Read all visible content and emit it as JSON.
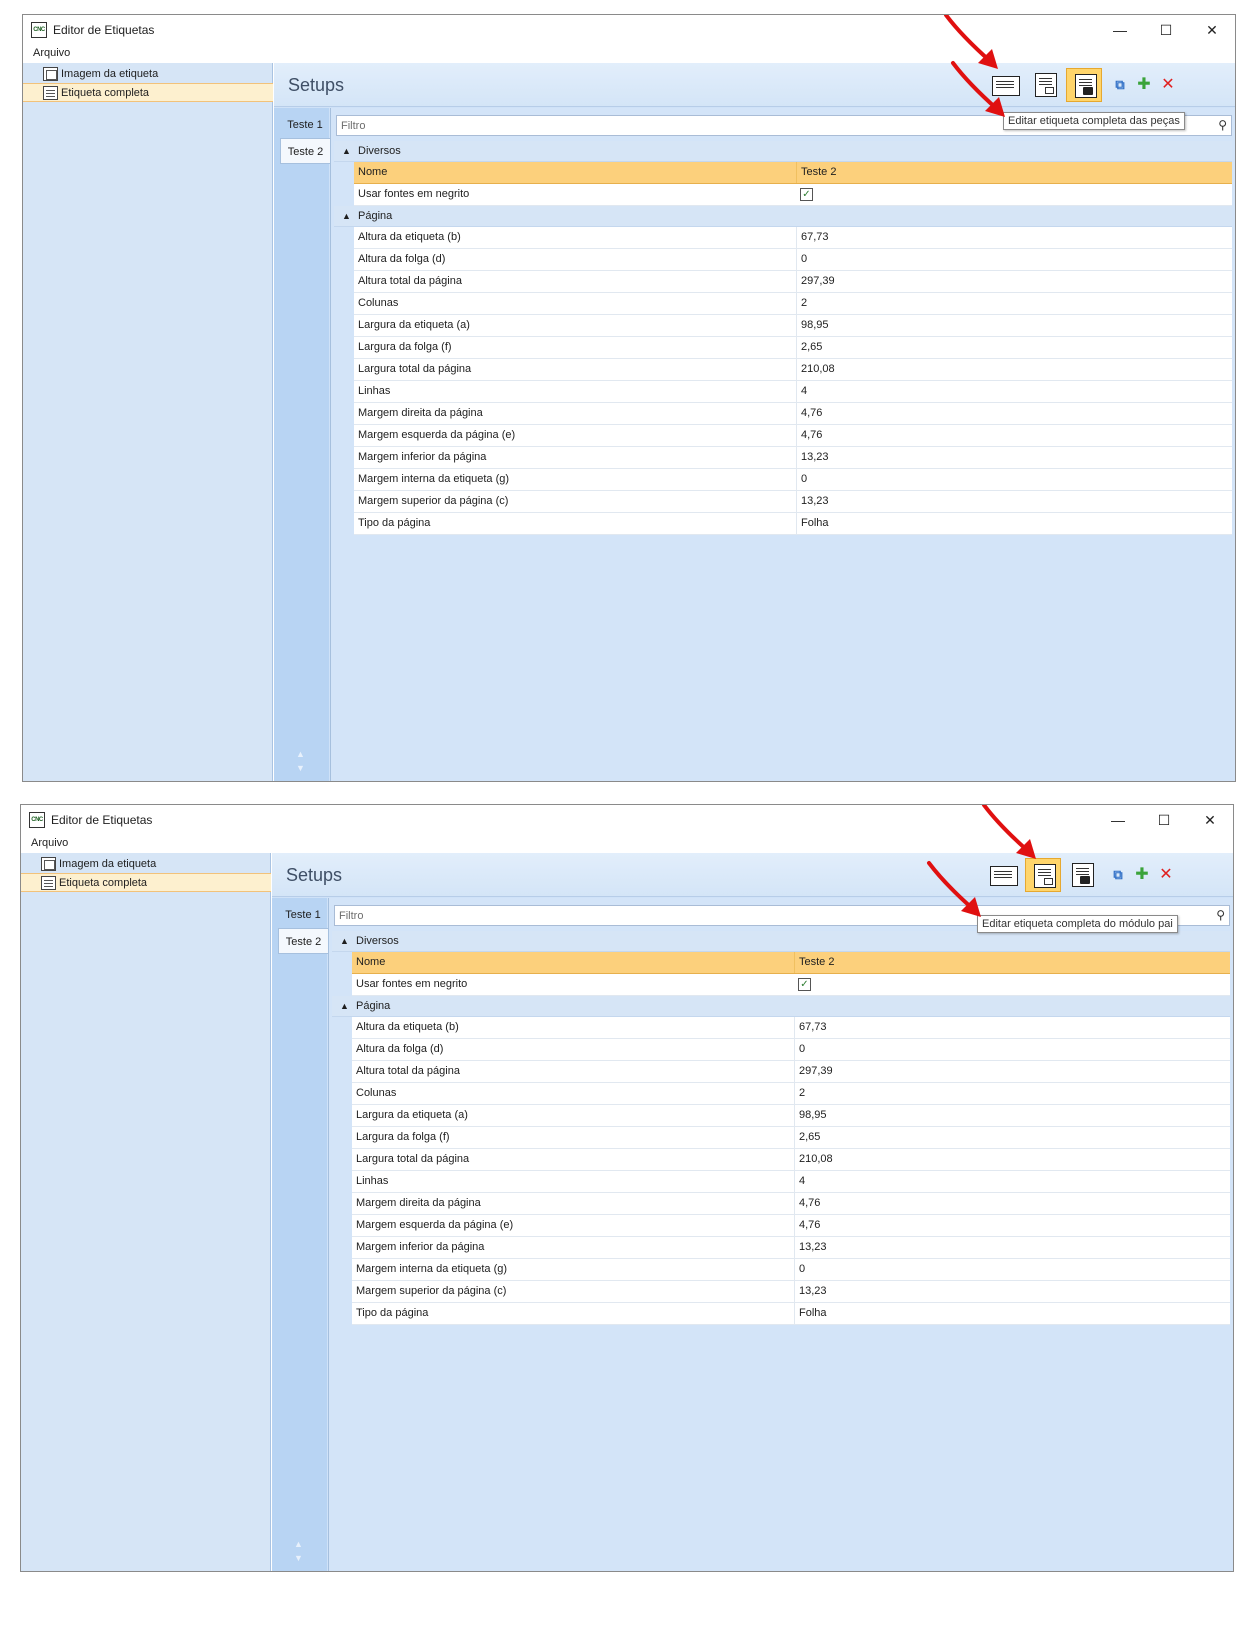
{
  "window": {
    "title": "Editor de Etiquetas",
    "logo_text": "CNC",
    "menu_file": "Arquivo",
    "controls": {
      "minimize": "—",
      "maximize": "☐",
      "close": "✕"
    }
  },
  "sidebar": {
    "items": [
      {
        "label": "Imagem da etiqueta",
        "icon": "image-label-icon"
      },
      {
        "label": "Etiqueta completa",
        "icon": "full-label-icon",
        "selected": true
      }
    ]
  },
  "content": {
    "title": "Setups",
    "toolbar": {
      "copy_icon": "copy-icon",
      "add_icon": "add-icon",
      "delete_icon": "delete-icon"
    },
    "tabs": [
      "Teste 1",
      "Teste 2"
    ],
    "active_tab": "Teste 2",
    "filter_placeholder": "Filtro",
    "categories": [
      {
        "label": "Diversos",
        "header": {
          "name": "Nome",
          "value": "Teste 2"
        },
        "rows": [
          {
            "name": "Usar fontes em negrito",
            "value": "✓",
            "type": "checkbox"
          }
        ]
      },
      {
        "label": "Página",
        "rows": [
          {
            "name": "Altura da etiqueta (b)",
            "value": "67,73"
          },
          {
            "name": "Altura da folga (d)",
            "value": "0"
          },
          {
            "name": "Altura total da página",
            "value": "297,39"
          },
          {
            "name": "Colunas",
            "value": "2"
          },
          {
            "name": "Largura da etiqueta (a)",
            "value": "98,95"
          },
          {
            "name": "Largura da folga (f)",
            "value": "2,65"
          },
          {
            "name": "Largura total da página",
            "value": "210,08"
          },
          {
            "name": "Linhas",
            "value": "4"
          },
          {
            "name": "Margem direita da página",
            "value": "4,76"
          },
          {
            "name": "Margem esquerda da página (e)",
            "value": "4,76"
          },
          {
            "name": "Margem inferior da página",
            "value": "13,23"
          },
          {
            "name": "Margem interna da etiqueta (g)",
            "value": "0"
          },
          {
            "name": "Margem superior da página (c)",
            "value": "13,23"
          },
          {
            "name": "Tipo da página",
            "value": "Folha"
          }
        ]
      }
    ]
  },
  "tooltips": {
    "top": "Editar etiqueta completa das peças",
    "bottom": "Editar etiqueta completa do módulo pai"
  },
  "colors": {
    "selected_bg": "#fdf0cf",
    "header_row": "#fcd07c",
    "active_button": "#ffd56b",
    "arrow": "#e01010"
  }
}
